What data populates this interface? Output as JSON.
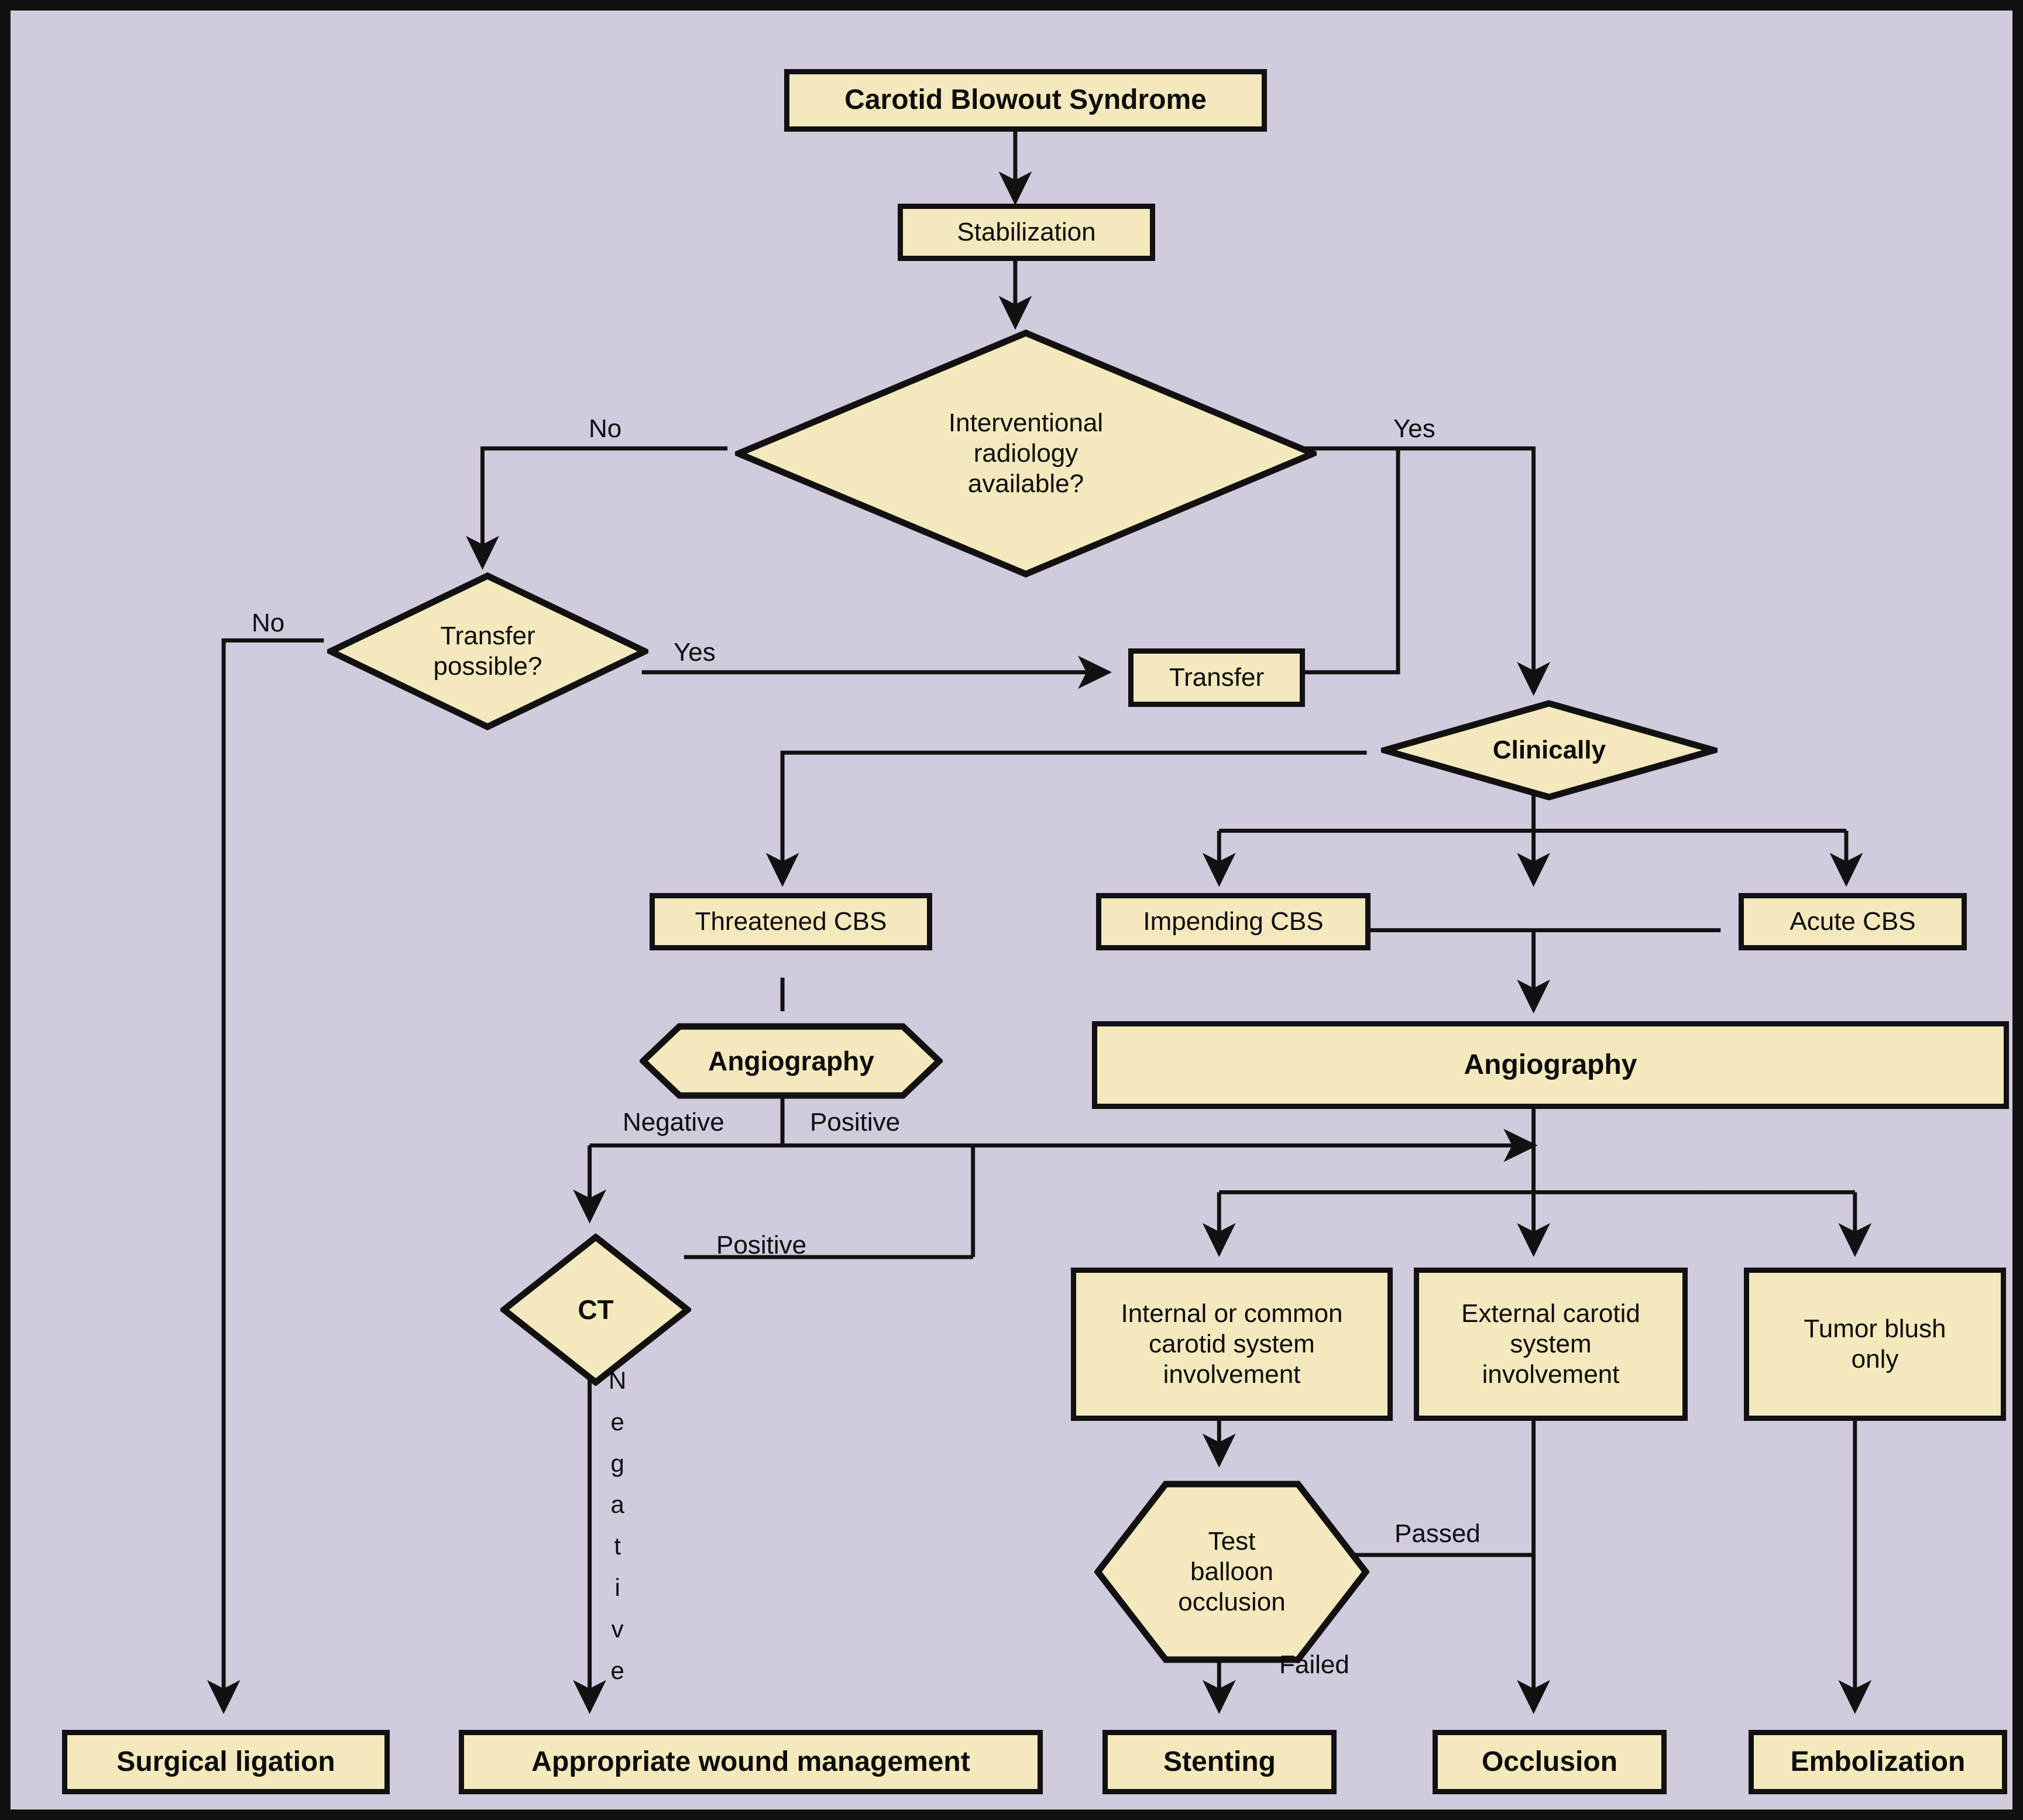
{
  "figure": {
    "type": "flowchart",
    "title": "Carotid Blowout Syndrome management algorithm",
    "background_color": "#d2cadd",
    "node_fill_color": "#f4e8bd",
    "node_border_color": "#111111",
    "text_color": "#0d0d0d"
  },
  "nodes": {
    "carotid_blowout_syndrome": {
      "label": "Carotid Blowout Syndrome",
      "shape": "rect",
      "bold": true
    },
    "stabilization": {
      "label": "Stabilization",
      "shape": "rect",
      "bold": false
    },
    "interventional_radiology_available": {
      "label": "Interventional\nradiology\navailable?",
      "line1": "Interventional",
      "line2": "radiology",
      "line3": "available?",
      "shape": "diamond",
      "bold": false
    },
    "transfer_possible": {
      "label": "Transfer\npossible?",
      "line1": "Transfer",
      "line2": "possible?",
      "shape": "diamond",
      "bold": false
    },
    "transfer": {
      "label": "Transfer",
      "shape": "rect",
      "bold": false
    },
    "clinically": {
      "label": "Clinically",
      "shape": "diamond",
      "bold": true
    },
    "threatened_cbs": {
      "label": "Threatened CBS",
      "shape": "rect",
      "bold": false
    },
    "impending_cbs": {
      "label": "Impending CBS",
      "shape": "rect",
      "bold": false
    },
    "acute_cbs": {
      "label": "Acute CBS",
      "shape": "rect",
      "bold": false
    },
    "angiography_threatened": {
      "label": "Angiography",
      "shape": "hexagon",
      "bold": true
    },
    "angiography_main": {
      "label": "Angiography",
      "shape": "rect",
      "bold": true
    },
    "ct": {
      "label": "CT",
      "shape": "diamond",
      "bold": true
    },
    "internal_common_carotid": {
      "label": "Internal or common carotid system involvement",
      "line1": "Internal or common",
      "line2": "carotid system",
      "line3": "involvement",
      "shape": "rect",
      "bold": false
    },
    "external_carotid": {
      "label": "External carotid system involvement",
      "line1": "External carotid",
      "line2": "system",
      "line3": "involvement",
      "shape": "rect",
      "bold": false
    },
    "tumor_blush_only": {
      "label": "Tumor blush only",
      "line1": "Tumor blush",
      "line2": "only",
      "shape": "rect",
      "bold": false
    },
    "test_balloon_occlusion": {
      "label": "Test balloon occlusion",
      "line1": "Test",
      "line2": "balloon",
      "line3": "occlusion",
      "shape": "hexagon",
      "bold": false
    },
    "surgical_ligation": {
      "label": "Surgical ligation",
      "shape": "rect",
      "bold": true
    },
    "appropriate_wound_management": {
      "label": "Appropriate wound management",
      "shape": "rect",
      "bold": true
    },
    "stenting": {
      "label": "Stenting",
      "shape": "rect",
      "bold": true
    },
    "occlusion": {
      "label": "Occlusion",
      "shape": "rect",
      "bold": true
    },
    "embolization": {
      "label": "Embolization",
      "shape": "rect",
      "bold": true
    }
  },
  "edge_labels": {
    "ir_no": "No",
    "ir_yes": "Yes",
    "transfer_no": "No",
    "transfer_yes": "Yes",
    "angio_negative": "Negative",
    "angio_positive": "Positive",
    "ct_positive": "Positive",
    "ct_negative_letters": [
      "N",
      "e",
      "g",
      "a",
      "t",
      "i",
      "v",
      "e"
    ],
    "tbo_passed": "Passed",
    "tbo_failed": "Failed"
  }
}
